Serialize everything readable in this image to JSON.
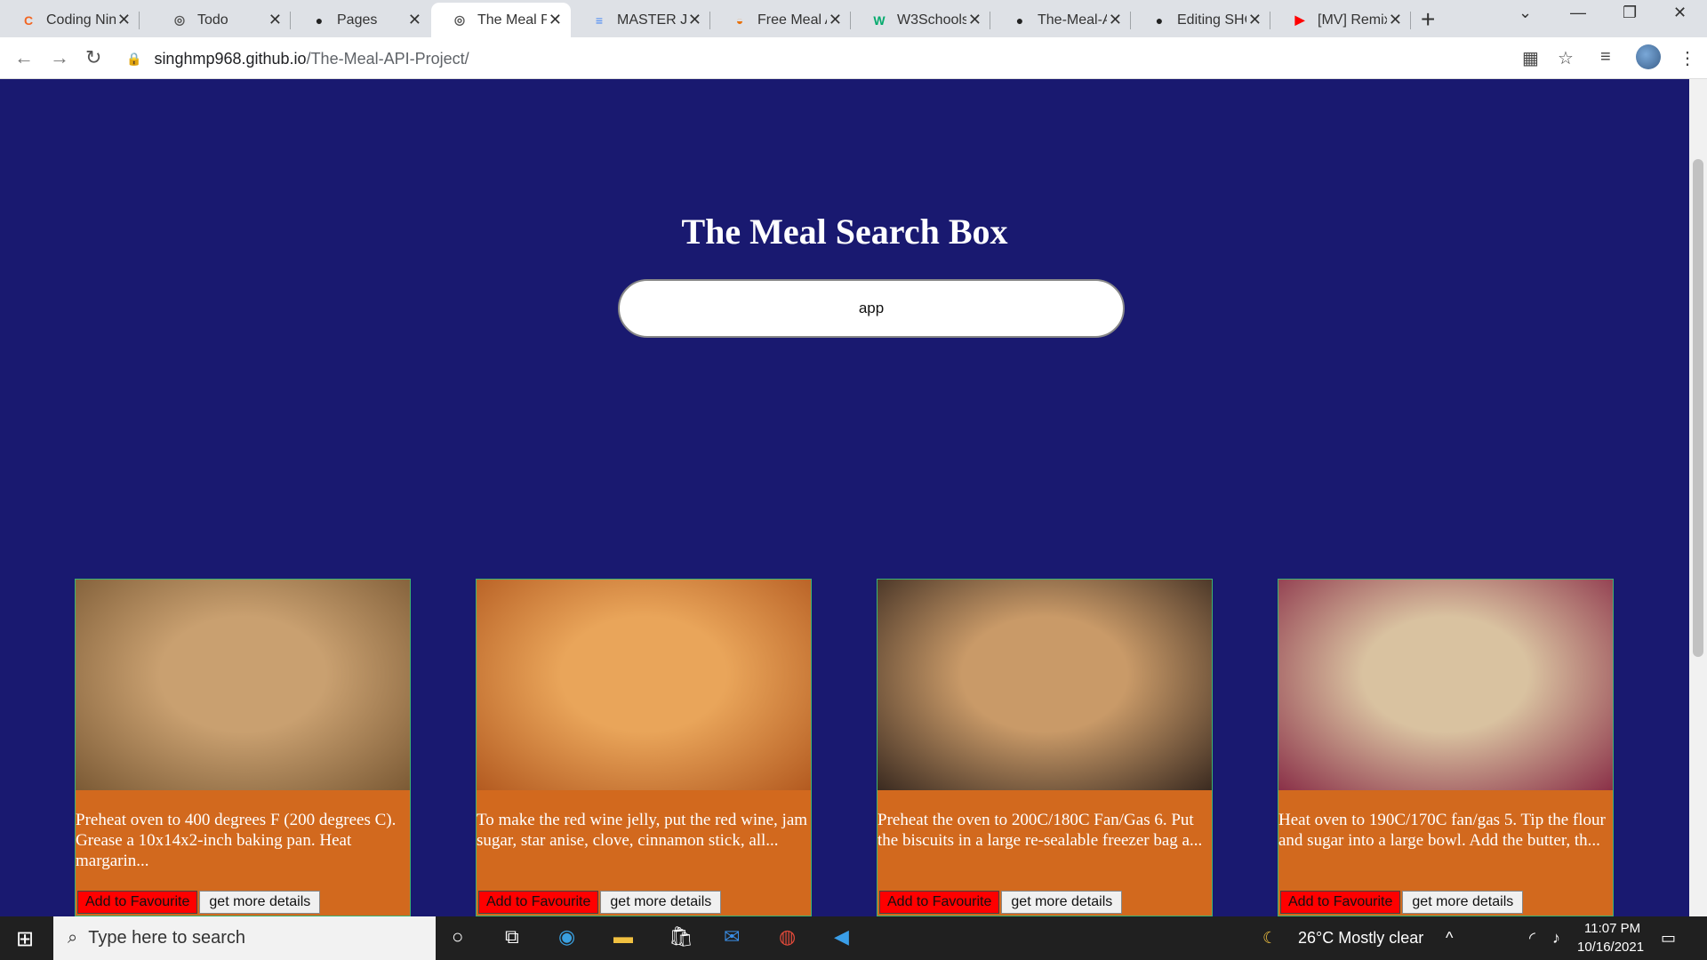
{
  "tabs": [
    {
      "label": "Coding Ninjas",
      "icon": "coding-ninjas-icon",
      "glyph": "C",
      "color": "#f26522"
    },
    {
      "label": "Todo",
      "icon": "globe-icon",
      "glyph": "◎",
      "color": "#555555"
    },
    {
      "label": "Pages",
      "icon": "github-icon",
      "glyph": "●",
      "color": "#222222"
    },
    {
      "label": "The Meal Project",
      "icon": "globe-icon",
      "glyph": "◎",
      "color": "#555555"
    },
    {
      "label": "MASTER JS",
      "icon": "docs-icon",
      "glyph": "≡",
      "color": "#4285f4"
    },
    {
      "label": "Free Meal API",
      "icon": "meal-icon",
      "glyph": "◒",
      "color": "#e8710a"
    },
    {
      "label": "W3Schools",
      "icon": "w3schools-icon",
      "glyph": "W",
      "color": "#04aa6d"
    },
    {
      "label": "The-Meal-API",
      "icon": "github-icon",
      "glyph": "●",
      "color": "#222222"
    },
    {
      "label": "Editing SHOWCASE",
      "icon": "github-icon",
      "glyph": "●",
      "color": "#222222"
    },
    {
      "label": "[MV] Remix",
      "icon": "youtube-icon",
      "glyph": "▶",
      "color": "#ff0000"
    }
  ],
  "url": {
    "host": "singhmp968.github.io",
    "path": "/The-Meal-API-Project/"
  },
  "page": {
    "title": "The Meal Search Box",
    "search_value": "app"
  },
  "meals": [
    {
      "desc": "Preheat oven to 400 degrees F (200 degrees C). Grease a 10x14x2-inch baking pan. Heat margarin...",
      "fav": "Add to Favourite",
      "details": "get more details",
      "colors": [
        "#c9a070",
        "#7b5a35"
      ]
    },
    {
      "desc": "To make the red wine jelly, put the red wine, jam sugar, star anise, clove, cinnamon stick, all...",
      "fav": "Add to Favourite",
      "details": "get more details",
      "colors": [
        "#e9a55a",
        "#b35a20"
      ]
    },
    {
      "desc": "Preheat the oven to 200C/180C Fan/Gas 6. Put the biscuits in a large re-sealable freezer bag a...",
      "fav": "Add to Favourite",
      "details": "get more details",
      "colors": [
        "#c99a68",
        "#3a2a20"
      ]
    },
    {
      "desc": "Heat oven to 190C/170C fan/gas 5. Tip the flour and sugar into a large bowl. Add the butter, th...",
      "fav": "Add to Favourite",
      "details": "get more details",
      "colors": [
        "#d9c2a0",
        "#8a3048"
      ]
    }
  ],
  "taskbar": {
    "search_placeholder": "Type here to search",
    "weather": "26°C  Mostly clear",
    "time": "11:07 PM",
    "date": "10/16/2021"
  }
}
